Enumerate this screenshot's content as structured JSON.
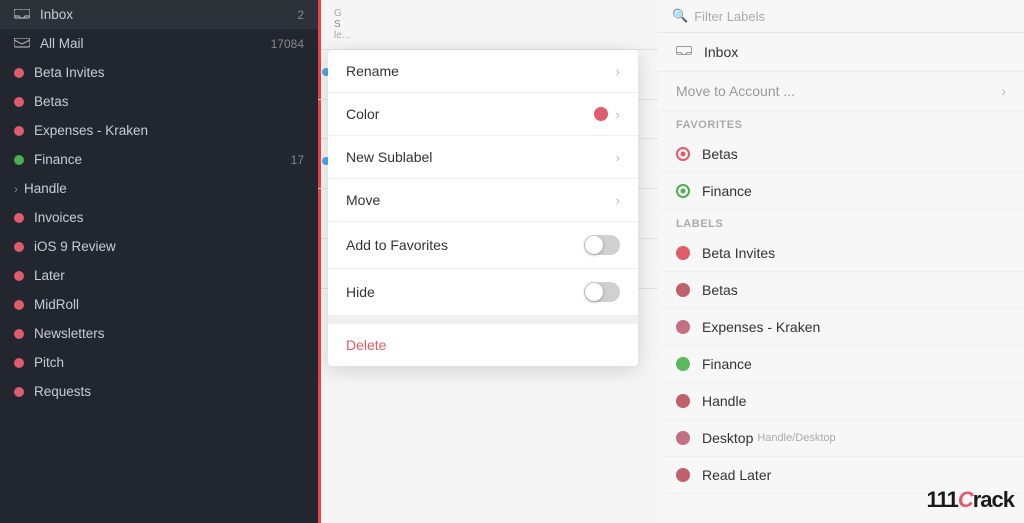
{
  "sidebar": {
    "items": [
      {
        "id": "inbox",
        "label": "Inbox",
        "count": "2",
        "type": "inbox",
        "dot": null
      },
      {
        "id": "all-mail",
        "label": "All Mail",
        "count": "17084",
        "type": "all-mail",
        "dot": null
      },
      {
        "id": "beta-invites",
        "label": "Beta Invites",
        "count": "",
        "type": "label",
        "dot": "#e05c6a"
      },
      {
        "id": "betas",
        "label": "Betas",
        "count": "",
        "type": "label",
        "dot": "#e05c6a"
      },
      {
        "id": "expenses-kraken",
        "label": "Expenses - Kraken",
        "count": "",
        "type": "label",
        "dot": "#e05c6a"
      },
      {
        "id": "finance",
        "label": "Finance",
        "count": "17",
        "type": "label",
        "dot": "#4caf50"
      },
      {
        "id": "handle",
        "label": "Handle",
        "count": "",
        "type": "handle",
        "dot": null,
        "hasChevron": true
      },
      {
        "id": "invoices",
        "label": "Invoices",
        "count": "",
        "type": "label",
        "dot": "#e05c6a"
      },
      {
        "id": "ios-9-review",
        "label": "iOS 9 Review",
        "count": "",
        "type": "label",
        "dot": "#e05c6a"
      },
      {
        "id": "later",
        "label": "Later",
        "count": "",
        "type": "label",
        "dot": "#e05c6a"
      },
      {
        "id": "midroll",
        "label": "MidRoll",
        "count": "",
        "type": "label",
        "dot": "#e05c6a"
      },
      {
        "id": "newsletters",
        "label": "Newsletters",
        "count": "",
        "type": "label",
        "dot": "#e05c6a"
      },
      {
        "id": "pitch",
        "label": "Pitch",
        "count": "",
        "type": "label",
        "dot": "#e05c6a"
      },
      {
        "id": "requests",
        "label": "Requests",
        "count": "",
        "type": "label",
        "dot": "#e05c6a"
      }
    ]
  },
  "contextMenu": {
    "items": [
      {
        "id": "rename",
        "label": "Rename",
        "hasChevron": true,
        "type": "normal"
      },
      {
        "id": "color",
        "label": "Color",
        "hasColorDot": true,
        "hasChevron": true,
        "type": "normal"
      },
      {
        "id": "new-sublabel",
        "label": "New Sublabel",
        "hasChevron": true,
        "type": "normal"
      },
      {
        "id": "move",
        "label": "Move",
        "hasChevron": true,
        "type": "normal"
      },
      {
        "id": "add-to-favorites",
        "label": "Add to Favorites",
        "hasToggle": true,
        "type": "normal"
      },
      {
        "id": "hide",
        "label": "Hide",
        "hasToggle": true,
        "type": "normal"
      }
    ],
    "deleteLabel": "Delete"
  },
  "rightPanel": {
    "filterPlaceholder": "Filter Labels",
    "inboxLabel": "Inbox",
    "moveToAccount": "Move to Account ...",
    "sections": {
      "favorites": {
        "header": "FAVORITES",
        "items": [
          {
            "id": "betas-fav",
            "label": "Betas",
            "dotColor": "#e05c6a",
            "dotOutline": true
          },
          {
            "id": "finance-fav",
            "label": "Finance",
            "dotColor": "#4caf50",
            "dotOutline": true
          }
        ]
      },
      "labels": {
        "header": "LABELS",
        "items": [
          {
            "id": "beta-invites-lbl",
            "label": "Beta Invites",
            "dotColor": "#e05c6a",
            "sublabel": ""
          },
          {
            "id": "betas-lbl",
            "label": "Betas",
            "dotColor": "#c0616b",
            "sublabel": ""
          },
          {
            "id": "expenses-kraken-lbl",
            "label": "Expenses - Kraken",
            "dotColor": "#c47080",
            "sublabel": ""
          },
          {
            "id": "finance-lbl",
            "label": "Finance",
            "dotColor": "#5cb85c",
            "sublabel": ""
          },
          {
            "id": "handle-lbl",
            "label": "Handle",
            "dotColor": "#c0606a",
            "sublabel": ""
          },
          {
            "id": "desktop-lbl",
            "label": "Desktop",
            "sublabelText": "Handle/Desktop",
            "dotColor": "#c47080",
            "sublabel": "Handle/Desktop"
          },
          {
            "id": "read-later-lbl",
            "label": "Read Later",
            "dotColor": "#c0606a",
            "sublabel": ""
          }
        ]
      }
    }
  },
  "watermark": {
    "text1": "111",
    "text2": "C",
    "text3": "rack"
  }
}
